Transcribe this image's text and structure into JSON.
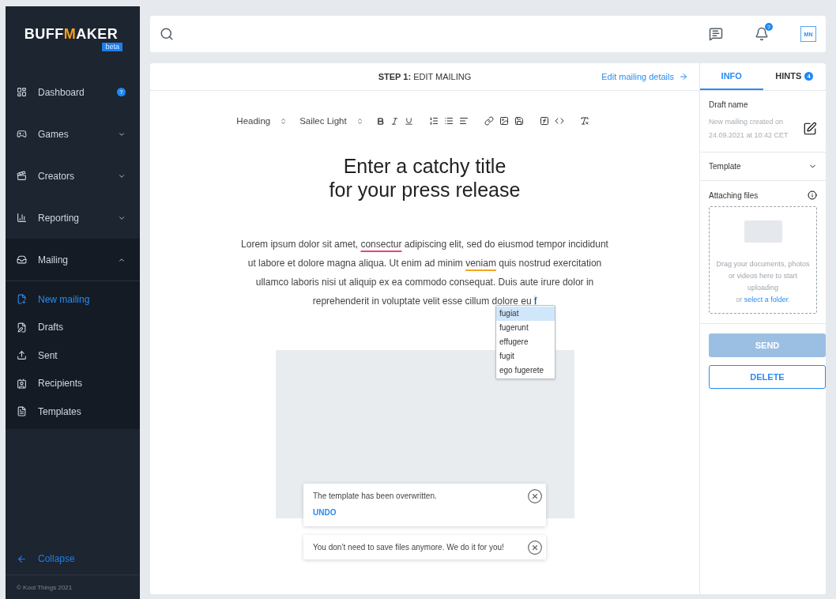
{
  "logo": {
    "text": "BUFFMAKER",
    "badge": "beta"
  },
  "sidebar": {
    "items": [
      {
        "label": "Dashboard",
        "kind": "link",
        "badge": "?"
      },
      {
        "label": "Games",
        "kind": "group",
        "expanded": false
      },
      {
        "label": "Creators",
        "kind": "group",
        "expanded": false
      },
      {
        "label": "Reporting",
        "kind": "group",
        "expanded": false
      },
      {
        "label": "Mailing",
        "kind": "group",
        "expanded": true,
        "children": [
          {
            "label": "New mailing",
            "selected": true
          },
          {
            "label": "Drafts",
            "selected": false
          },
          {
            "label": "Sent",
            "selected": false
          },
          {
            "label": "Recipients",
            "selected": false
          },
          {
            "label": "Templates",
            "selected": false
          }
        ]
      }
    ],
    "collapse": "Collapse",
    "copyright": "© Kool Things 2021"
  },
  "topbar": {
    "notifications_badge": "?",
    "avatar": "MN"
  },
  "editor": {
    "step": "**STEP 1:** EDIT MAILING",
    "details_link": "Edit mailing details",
    "toolbar": {
      "block": "Heading",
      "font": "Sailec Light"
    },
    "title": "Enter a catchy title\nfor your press release",
    "paragraph": [
      {
        "kind": "plain",
        "text": "Lorem ipsum dolor sit amet, "
      },
      {
        "kind": "spelling",
        "text": "consectur"
      },
      {
        "kind": "plain",
        "text": " adipiscing elit, sed do eiusmod tempor incididunt ut labore et dolore magna aliqua. Ut enim ad minim "
      },
      {
        "kind": "grammar",
        "text": "veniam"
      },
      {
        "kind": "plain",
        "text": " quis nostrud exercitation ullamco laboris nisi ut aliquip ex ea commodo consequat. Duis aute irure dolor in reprehenderit in voluptate velit esse cillum dolore eu "
      },
      {
        "kind": "active",
        "text": "f"
      }
    ],
    "suggestions": [
      {
        "text": "fugiat",
        "selected": true
      },
      {
        "text": "fugerunt",
        "selected": false
      },
      {
        "text": "effugere",
        "selected": false
      },
      {
        "text": "fugit",
        "selected": false
      },
      {
        "text": "ego fugerete",
        "selected": false
      }
    ],
    "image": {
      "kind": "placeholder"
    },
    "toasts": [
      {
        "message": "The template has been overwritten.",
        "action": "UNDO"
      },
      {
        "message": "You don’t need to save files anymore. We do it for you!"
      }
    ]
  },
  "panel": {
    "tabs": [
      {
        "label": "INFO",
        "selected": true
      },
      {
        "label": "HINTS",
        "badge": "4",
        "selected": false
      }
    ],
    "draft_label": "Draft name",
    "draft_value": "New mailing created on 24.09.2021 at 10:42 CET",
    "template_label": "Template",
    "attach_label": "Attaching files",
    "drop_text": "Drag your documents, photos or videos here to start uploading",
    "drop_or": "or",
    "drop_link": "select a folder",
    "drop_end": ".",
    "buttons": [
      {
        "label": "SEND",
        "kind": "primary",
        "disabled": true
      },
      {
        "label": "DELETE",
        "kind": "outline",
        "disabled": false
      }
    ]
  }
}
